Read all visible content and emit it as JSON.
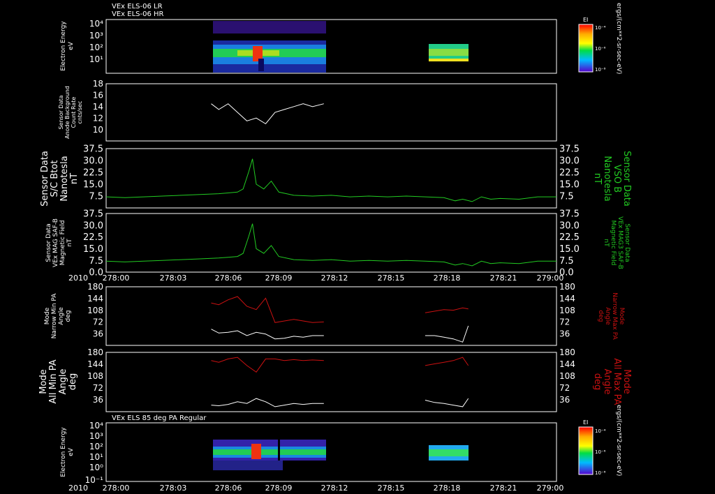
{
  "header": {
    "title_lr": "VEx ELS-06 LR",
    "title_hr": "VEx ELS-06 HR",
    "title_pa": "VEx ELS 85 deg PA Regular"
  },
  "x_axis": {
    "year": "2010",
    "ticks": [
      "278:00",
      "278:03",
      "278:06",
      "278:09",
      "278:12",
      "278:15",
      "278:18",
      "278:21",
      "279:00"
    ]
  },
  "colorbar": {
    "label": "EI",
    "ticks": [
      "10⁻⁴",
      "10⁻⁶",
      "10⁻⁸"
    ],
    "units": "ergs/(cm**2-sr-sec-eV)"
  },
  "colors": {
    "magfield": "#22cc22",
    "min_pa": "#ffffff",
    "max_pa": "#cc1111"
  },
  "chart_data": [
    {
      "type": "heatmap",
      "name": "VEx ELS-06 LR / VEx ELS-06 HR",
      "ylabel": [
        "Electron Energy",
        "eV"
      ],
      "yticks": [
        "10⁴",
        "10³",
        "10²",
        "10¹"
      ],
      "yscale": "log",
      "data_intervals": [
        [
          "278:05.6",
          "278:11.6"
        ],
        [
          "278:17.0",
          "278:19.3"
        ]
      ]
    },
    {
      "type": "line",
      "name": "Sensor Data Anode Background Count Rate",
      "ylabel": [
        "Sensor Data",
        "Anode Background",
        "Count Rate",
        "cnts/sec"
      ],
      "ylim": [
        8,
        18
      ],
      "yticks": [
        "18",
        "16",
        "14",
        "12",
        "10"
      ],
      "series": [
        {
          "x": [
            5.6,
            6.0,
            6.5,
            7.0,
            7.5,
            8.0,
            8.5,
            9.0,
            9.5,
            10.0,
            10.5,
            11.0,
            11.6
          ],
          "y": [
            14.5,
            13.5,
            14.5,
            13.0,
            11.5,
            12.0,
            11.0,
            13.0,
            13.5,
            14.0,
            14.5,
            14.0,
            14.5
          ]
        }
      ]
    },
    {
      "type": "line",
      "name": "S/C Btot",
      "ylabel": [
        "Sensor Data",
        "S/C Btot",
        "Nanotesla",
        "nT"
      ],
      "ylabel_right": [
        "Sensor Data",
        "VSO B",
        "Nanotesla",
        "nT"
      ],
      "ylim": [
        0,
        37.5
      ],
      "yticks": [
        "37.5",
        "30.0",
        "22.5",
        "15.0",
        "7.5"
      ],
      "series": [
        {
          "x": [
            0,
            1,
            2,
            3,
            4,
            5,
            6,
            6.5,
            7,
            7.3,
            7.6,
            7.8,
            8.0,
            8.4,
            8.8,
            9.2,
            10,
            11,
            12,
            13,
            14,
            15,
            16,
            17,
            18,
            18.6,
            19,
            19.5,
            20,
            20.5,
            21,
            22,
            23,
            24
          ],
          "y": [
            7,
            6.5,
            7,
            7.5,
            8,
            8.5,
            9,
            9.5,
            10,
            12,
            23,
            31,
            15,
            12,
            17,
            10,
            8,
            7.5,
            8,
            7,
            7.5,
            7,
            7.5,
            7,
            6.5,
            4.5,
            5.5,
            4,
            7,
            5.5,
            6,
            5.5,
            7,
            7
          ]
        }
      ]
    },
    {
      "type": "line",
      "name": "VEx MAG SAF-B Magnetic Field",
      "ylabel": [
        "Sensor Data",
        "VEx MAG SAF-B",
        "Magnetic Field",
        "nT"
      ],
      "ylabel_right": [
        "Sensor Data",
        "VEx MAG3 SAF-B",
        "Magnetic Field",
        "nT"
      ],
      "ylim": [
        0,
        37.5
      ],
      "yticks": [
        "37.5",
        "30.0",
        "22.5",
        "15.0",
        "7.5",
        "0.0"
      ],
      "series": [
        {
          "x": [
            0,
            1,
            2,
            3,
            4,
            5,
            6,
            6.5,
            7,
            7.3,
            7.6,
            7.8,
            8.0,
            8.4,
            8.8,
            9.2,
            10,
            11,
            12,
            13,
            14,
            15,
            16,
            17,
            18,
            18.6,
            19,
            19.5,
            20,
            20.5,
            21,
            22,
            23,
            24
          ],
          "y": [
            7,
            6.5,
            7,
            7.5,
            8,
            8.5,
            9,
            9.5,
            10,
            12,
            23,
            31,
            15,
            12,
            17,
            10,
            8,
            7.5,
            8,
            7,
            7.5,
            7,
            7.5,
            7,
            6.5,
            4.5,
            5.5,
            4,
            7,
            5.5,
            6,
            5.5,
            7,
            7
          ]
        }
      ]
    },
    {
      "type": "line",
      "name": "Narrow Min/Max PA",
      "ylabel": [
        "Mode",
        "Narrow Min PA",
        "Angle",
        "deg"
      ],
      "ylabel_right": [
        "Mode",
        "Narrow Max PA",
        "Angle",
        "deg"
      ],
      "ylim": [
        0,
        180
      ],
      "yticks": [
        "180",
        "144",
        "108",
        "72",
        "36"
      ],
      "series": [
        {
          "x": [
            5.6,
            6.0,
            6.5,
            7.0,
            7.5,
            8.0,
            8.5,
            9.0,
            9.5,
            10.0,
            10.5,
            11.0,
            11.6,
            17.0,
            17.5,
            18.0,
            18.5,
            19.0,
            19.3
          ],
          "y": [
            50,
            38,
            40,
            45,
            30,
            40,
            35,
            20,
            22,
            28,
            25,
            30,
            30,
            30,
            30,
            25,
            20,
            10,
            60
          ]
        },
        {
          "x": [
            5.6,
            6.0,
            6.5,
            7.0,
            7.5,
            8.0,
            8.5,
            9.0,
            9.5,
            10.0,
            10.5,
            11.0,
            11.6,
            17.0,
            17.5,
            18.0,
            18.5,
            19.0,
            19.3
          ],
          "y": [
            130,
            125,
            140,
            150,
            120,
            110,
            145,
            70,
            75,
            80,
            75,
            70,
            72,
            100,
            105,
            110,
            108,
            115,
            112
          ]
        }
      ]
    },
    {
      "type": "line",
      "name": "All Min/Max PA",
      "ylabel": [
        "Mode",
        "All Min PA",
        "Angle",
        "deg"
      ],
      "ylabel_right": [
        "Mode",
        "All Max PA",
        "Angle",
        "deg"
      ],
      "ylim": [
        0,
        180
      ],
      "yticks": [
        "180",
        "144",
        "108",
        "72",
        "36"
      ],
      "series": [
        {
          "x": [
            5.6,
            6.0,
            6.5,
            7.0,
            7.5,
            8.0,
            8.5,
            9.0,
            9.5,
            10.0,
            10.5,
            11.0,
            11.6,
            17.0,
            17.5,
            18.0,
            18.5,
            19.0,
            19.3
          ],
          "y": [
            20,
            18,
            22,
            30,
            25,
            40,
            30,
            15,
            20,
            25,
            22,
            25,
            25,
            35,
            28,
            25,
            20,
            15,
            40
          ]
        },
        {
          "x": [
            5.6,
            6.0,
            6.5,
            7.0,
            7.5,
            8.0,
            8.5,
            9.0,
            9.5,
            10.0,
            10.5,
            11.0,
            11.6,
            17.0,
            17.5,
            18.0,
            18.5,
            19.0,
            19.3
          ],
          "y": [
            155,
            150,
            160,
            165,
            140,
            120,
            160,
            160,
            155,
            158,
            155,
            157,
            155,
            140,
            145,
            150,
            155,
            165,
            140
          ]
        }
      ]
    },
    {
      "type": "heatmap",
      "name": "VEx ELS 85 deg PA Regular",
      "ylabel": [
        "Electron Energy",
        "eV"
      ],
      "yticks": [
        "10⁴",
        "10³",
        "10²",
        "10¹",
        "10⁰",
        "10⁻¹"
      ],
      "yscale": "log",
      "data_intervals": [
        [
          "278:05.6",
          "278:11.6"
        ],
        [
          "278:17.0",
          "278:19.3"
        ]
      ]
    }
  ]
}
